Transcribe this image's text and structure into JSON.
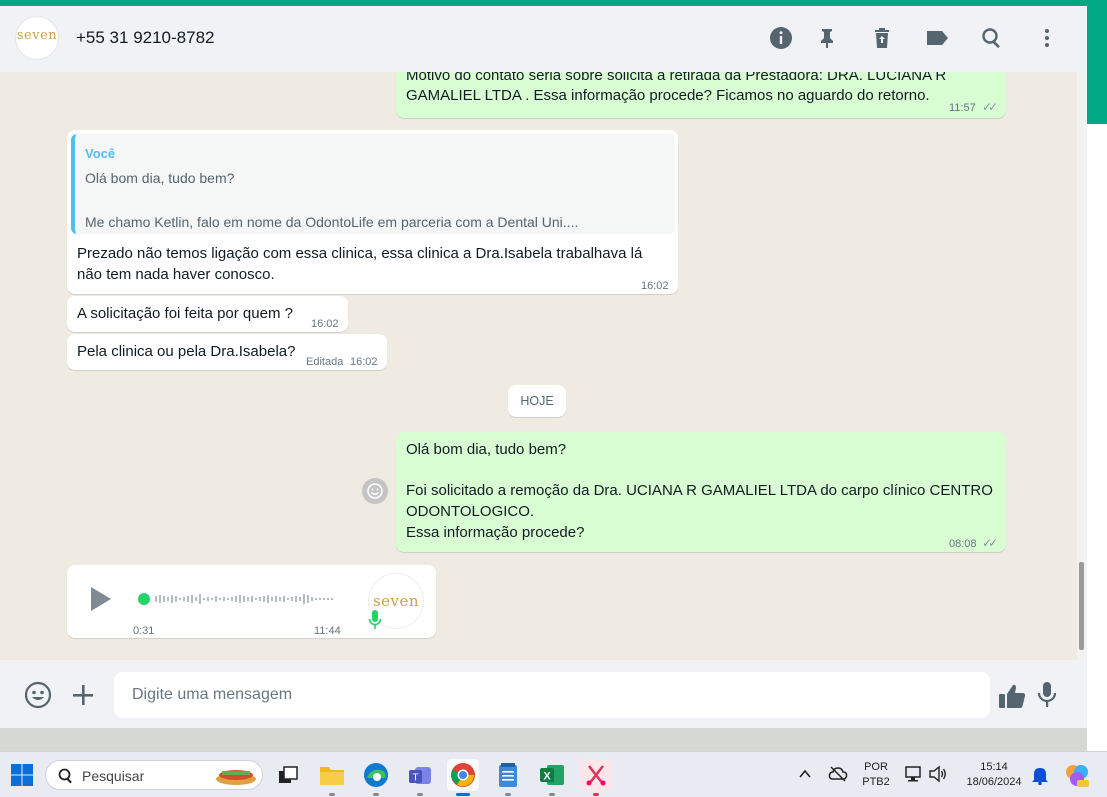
{
  "header": {
    "logo_text": "seven",
    "contact": "+55 31 9210-8782"
  },
  "chat": {
    "msg1": {
      "line1": "Motivo do contato seria sobre solicita a retirada da Prestadora:  DRA. LUCIANA R",
      "line2": "GAMALIEL LTDA . Essa informação procede? Ficamos no aguardo do retorno.",
      "time": "11:57"
    },
    "reply": {
      "quote_author": "Você",
      "quote_line1": "Olá bom dia, tudo bem?",
      "quote_line2": "Me chamo Ketlin, falo em nome da OdontoLife em parceria com a Dental Uni....",
      "text_line1": "Prezado não temos ligação com essa clinica, essa clinica a Dra.Isabela trabalhava lá",
      "text_line2": "não tem nada haver conosco.",
      "time": "16:02"
    },
    "msg3": {
      "text": "A solicitação foi feita por quem ?",
      "time": "16:02"
    },
    "msg4": {
      "text": "Pela clinica ou pela Dra.Isabela?",
      "edited": "Editada",
      "time": "16:02"
    },
    "date_divider": "HOJE",
    "msg5": {
      "line1": "Olá bom dia, tudo bem?",
      "line2": "Foi solicitado a remoção da Dra. UCIANA R GAMALIEL LTDA do carpo clínico CENTRO",
      "line3": "ODONTOLOGICO.",
      "line4": "Essa informação procede?",
      "time": "08:08"
    },
    "voice": {
      "duration": "0:31",
      "time": "11:44",
      "progress": 0.0
    }
  },
  "composer": {
    "placeholder": "Digite uma mensagem"
  },
  "taskbar": {
    "search_label": "Pesquisar",
    "lang_line1": "POR",
    "lang_line2": "PTB2",
    "clock_time": "15:14",
    "clock_date": "18/06/2024"
  },
  "colors": {
    "accent": "#00a884",
    "outgoing_bubble": "#d9fdd3",
    "incoming_bubble": "#ffffff",
    "quote_bar": "#53bdeb"
  },
  "icons": [
    "info-icon",
    "pin-icon",
    "delete-icon",
    "label-icon",
    "search-icon",
    "menu-icon",
    "emoji-icon",
    "plus-icon",
    "thumbs-up-icon",
    "mic-icon",
    "play-icon",
    "windows-start-icon"
  ]
}
